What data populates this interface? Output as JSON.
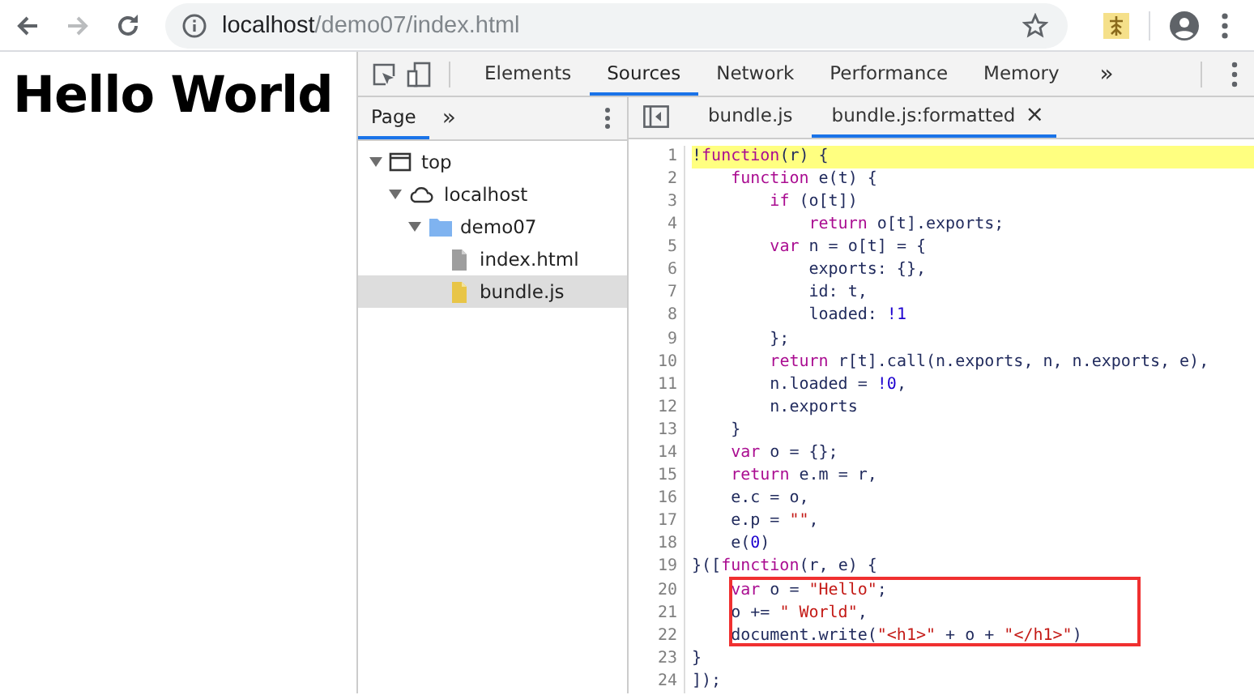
{
  "browser": {
    "url_host": "localhost",
    "url_path": "/demo07/index.html"
  },
  "page": {
    "heading": "Hello World"
  },
  "devtools": {
    "tabs": [
      {
        "label": "Elements",
        "selected": false
      },
      {
        "label": "Sources",
        "selected": true
      },
      {
        "label": "Network",
        "selected": false
      },
      {
        "label": "Performance",
        "selected": false
      },
      {
        "label": "Memory",
        "selected": false
      }
    ],
    "more_tabs": "»",
    "navigator": {
      "tabs": [
        {
          "label": "Page",
          "selected": true
        }
      ],
      "more_tabs": "»",
      "tree": [
        {
          "label": "top",
          "kind": "frame",
          "expanded": true,
          "selected": false,
          "children": [
            {
              "label": "localhost",
              "kind": "origin",
              "expanded": true,
              "selected": false,
              "children": [
                {
                  "label": "demo07",
                  "kind": "folder",
                  "expanded": true,
                  "selected": false,
                  "children": [
                    {
                      "label": "index.html",
                      "kind": "html",
                      "selected": false
                    },
                    {
                      "label": "bundle.js",
                      "kind": "script",
                      "selected": true
                    }
                  ]
                }
              ]
            }
          ]
        }
      ]
    },
    "editor_tabs": [
      {
        "label": "bundle.js",
        "selected": false,
        "closable": false
      },
      {
        "label": "bundle.js:formatted",
        "selected": true,
        "closable": true
      }
    ],
    "close_glyph": "×",
    "code": [
      {
        "number": "1",
        "text": "!function(r) {",
        "highlighted": true,
        "boxed": false
      },
      {
        "number": "2",
        "text": "    function e(t) {",
        "highlighted": false,
        "boxed": false
      },
      {
        "number": "3",
        "text": "        if (o[t])",
        "highlighted": false,
        "boxed": false
      },
      {
        "number": "4",
        "text": "            return o[t].exports;",
        "highlighted": false,
        "boxed": false
      },
      {
        "number": "5",
        "text": "        var n = o[t] = {",
        "highlighted": false,
        "boxed": false
      },
      {
        "number": "6",
        "text": "            exports: {},",
        "highlighted": false,
        "boxed": false
      },
      {
        "number": "7",
        "text": "            id: t,",
        "highlighted": false,
        "boxed": false
      },
      {
        "number": "8",
        "text": "            loaded: !1",
        "highlighted": false,
        "boxed": false
      },
      {
        "number": "9",
        "text": "        };",
        "highlighted": false,
        "boxed": false
      },
      {
        "number": "10",
        "text": "        return r[t].call(n.exports, n, n.exports, e),",
        "highlighted": false,
        "boxed": false
      },
      {
        "number": "11",
        "text": "        n.loaded = !0,",
        "highlighted": false,
        "boxed": false
      },
      {
        "number": "12",
        "text": "        n.exports",
        "highlighted": false,
        "boxed": false
      },
      {
        "number": "13",
        "text": "    }",
        "highlighted": false,
        "boxed": false
      },
      {
        "number": "14",
        "text": "    var o = {};",
        "highlighted": false,
        "boxed": false
      },
      {
        "number": "15",
        "text": "    return e.m = r,",
        "highlighted": false,
        "boxed": false
      },
      {
        "number": "16",
        "text": "    e.c = o,",
        "highlighted": false,
        "boxed": false
      },
      {
        "number": "17",
        "text": "    e.p = \"\",",
        "highlighted": false,
        "boxed": false
      },
      {
        "number": "18",
        "text": "    e(0)",
        "highlighted": false,
        "boxed": false
      },
      {
        "number": "19",
        "text": "}([function(r, e) {",
        "highlighted": false,
        "boxed": false
      },
      {
        "number": "20",
        "text": "    var o = \"Hello\";",
        "highlighted": false,
        "boxed": true
      },
      {
        "number": "21",
        "text": "    o += \" World\",",
        "highlighted": false,
        "boxed": true
      },
      {
        "number": "22",
        "text": "    document.write(\"<h1>\" + o + \"</h1>\")",
        "highlighted": false,
        "boxed": true
      },
      {
        "number": "23",
        "text": "}",
        "highlighted": false,
        "boxed": false
      },
      {
        "number": "24",
        "text": "]);",
        "highlighted": false,
        "boxed": false
      }
    ]
  }
}
